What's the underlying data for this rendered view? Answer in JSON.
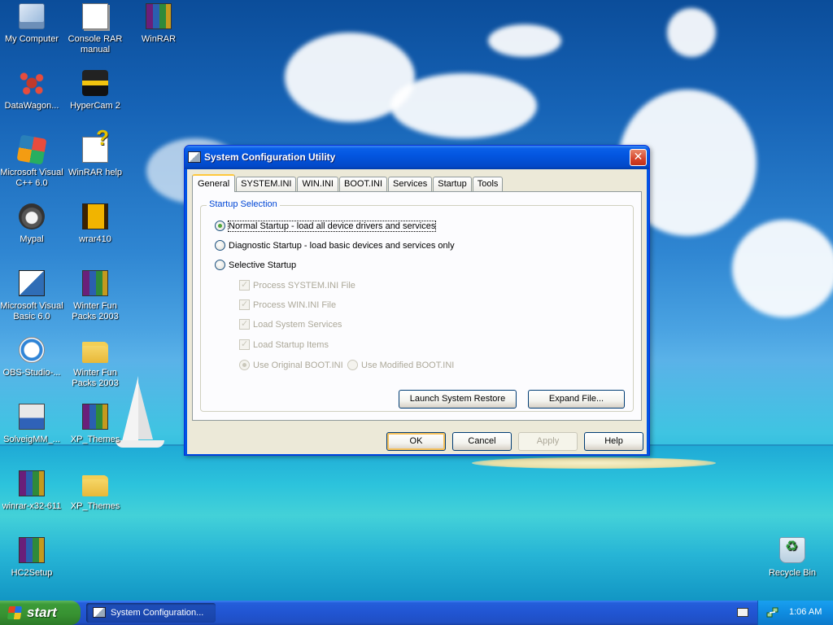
{
  "desktop": {
    "icons": [
      {
        "label": "My Computer",
        "icon": "computer-icon"
      },
      {
        "label": "DataWagon...",
        "icon": "molecule-icon"
      },
      {
        "label": "Microsoft Visual C++ 6.0",
        "icon": "visual-cpp-icon"
      },
      {
        "label": "Mypal",
        "icon": "raccoon-icon"
      },
      {
        "label": "Microsoft Visual Basic 6.0",
        "icon": "visual-basic-icon"
      },
      {
        "label": "OBS-Studio-...",
        "icon": "installer-icon"
      },
      {
        "label": "SolveigMM_...",
        "icon": "installer-icon"
      },
      {
        "label": "winrar-x32-611",
        "icon": "winrar-archive-icon"
      },
      {
        "label": "HC2Setup",
        "icon": "setup-icon"
      },
      {
        "label": "Console RAR manual",
        "icon": "text-document-icon"
      },
      {
        "label": "HyperCam 2",
        "icon": "camera-icon"
      },
      {
        "label": "WinRAR help",
        "icon": "help-file-icon"
      },
      {
        "label": "wrar410",
        "icon": "book-icon"
      },
      {
        "label": "Winter Fun Packs 2003",
        "icon": "winrar-archive-icon"
      },
      {
        "label": "Winter Fun Packs 2003",
        "icon": "folder-icon"
      },
      {
        "label": "XP_Themes",
        "icon": "winrar-archive-icon"
      },
      {
        "label": "XP_Themes",
        "icon": "folder-icon"
      },
      {
        "label": "WinRAR",
        "icon": "winrar-icon"
      },
      {
        "label": "Recycle Bin",
        "icon": "recycle-bin-icon"
      }
    ]
  },
  "window": {
    "title": "System Configuration Utility",
    "close_glyph": "✕",
    "tabs": [
      {
        "label": "General",
        "active": true
      },
      {
        "label": "SYSTEM.INI",
        "active": false
      },
      {
        "label": "WIN.INI",
        "active": false
      },
      {
        "label": "BOOT.INI",
        "active": false
      },
      {
        "label": "Services",
        "active": false
      },
      {
        "label": "Startup",
        "active": false
      },
      {
        "label": "Tools",
        "active": false
      }
    ],
    "general": {
      "group_title": "Startup Selection",
      "options": {
        "normal": "Normal Startup - load all device drivers and services",
        "diagnostic": "Diagnostic Startup - load basic devices and services only",
        "selective": "Selective Startup"
      },
      "selected": "normal",
      "selective_items": {
        "system_ini": "Process SYSTEM.INI File",
        "win_ini": "Process WIN.INI File",
        "system_services": "Load System Services",
        "startup_items": "Load Startup Items",
        "use_original_boot": "Use Original BOOT.INI",
        "use_modified_boot": "Use Modified BOOT.INI"
      },
      "launch_restore": "Launch System Restore",
      "expand_file": "Expand File..."
    },
    "buttons": {
      "ok": "OK",
      "cancel": "Cancel",
      "apply": "Apply",
      "help": "Help"
    }
  },
  "taskbar": {
    "start_label": "start",
    "task_button": "System Configuration...",
    "clock": "1:06 AM"
  }
}
